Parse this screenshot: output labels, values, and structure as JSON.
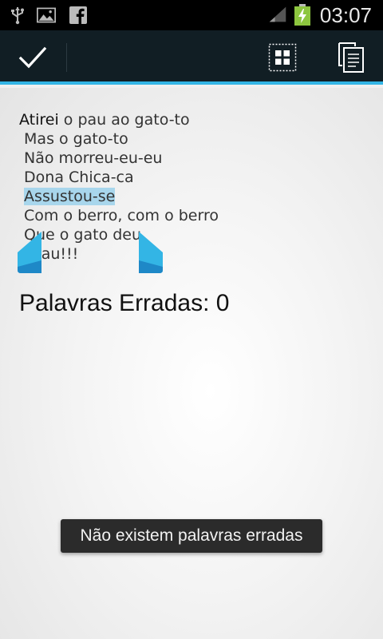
{
  "status_bar": {
    "time": "03:07",
    "icons": [
      "usb-icon",
      "gallery-icon",
      "facebook-icon",
      "signal-icon",
      "battery-charging-icon"
    ]
  },
  "action_bar": {
    "done_icon": "check-icon",
    "select_all_icon": "select-all-icon",
    "copy_icon": "copy-icon",
    "accent_color": "#33b5e5",
    "background_color": "#111e24"
  },
  "poem": {
    "line1_first": "Atirei",
    "line1_rest": " o pau ao gato-to",
    "line2": " Mas o gato-to",
    "line3": " Não morreu-eu-eu",
    "line4": " Dona Chica-ca",
    "line5_lead": " ",
    "line5_selected": "Assustou-se",
    "line6": " Com o berro, com o berro",
    "line7": " Que o gato deu",
    "line8": " Miau!!!"
  },
  "errors_label": "Palavras Erradas: 0",
  "toast": "Não existem palavras erradas",
  "colors": {
    "selection_highlight": "#a8d6ec",
    "handle": "#33b5e5"
  }
}
